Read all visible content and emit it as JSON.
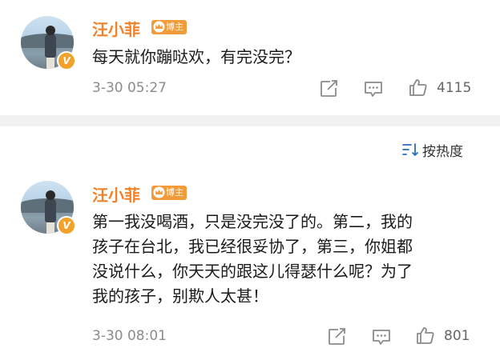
{
  "posts": [
    {
      "username": "汪小菲",
      "role_badge": "博主",
      "verified_mark": "V",
      "content_lines": [
        "每天就你蹦哒欢，有完没完？"
      ],
      "timestamp": "3-30 05:27",
      "like_count": "4115"
    },
    {
      "username": "汪小菲",
      "role_badge": "博主",
      "verified_mark": "V",
      "content_lines": [
        "第一我没喝酒，只是没完没了的。第二，我的",
        "孩子在台北，我已经很妥协了，第三，你姐都",
        "没说什么，你天天的跟这儿得瑟什么呢？为了",
        "我的孩子，别欺人太甚！"
      ],
      "timestamp": "3-30 08:01",
      "like_count": "801"
    }
  ],
  "sort": {
    "label": "按热度",
    "icon": "sort-icon"
  },
  "icons": {
    "share": "share-icon",
    "comment": "comment-icon",
    "like": "thumbs-up-icon"
  },
  "colors": {
    "username": "#f0822a",
    "badge": "#f29b3a",
    "verified": "#f2a12b",
    "meta": "#8c8c8c",
    "divider": "#f1f1f1"
  }
}
